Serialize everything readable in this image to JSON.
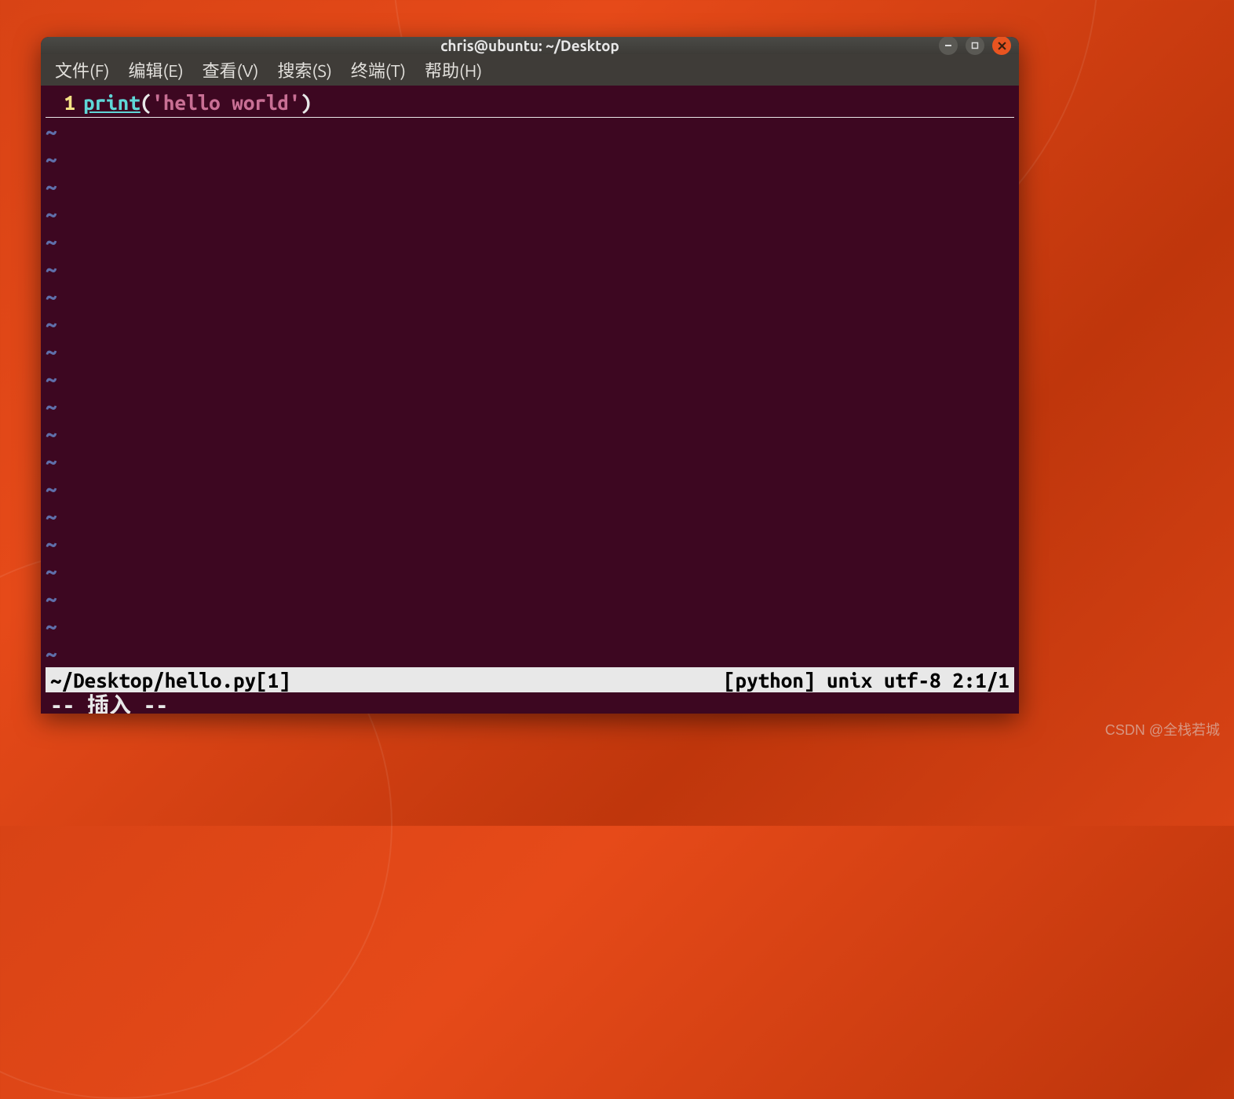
{
  "window": {
    "title": "chris@ubuntu: ~/Desktop"
  },
  "menubar": {
    "file": "文件(F)",
    "edit": "编辑(E)",
    "view": "查看(V)",
    "search": "搜索(S)",
    "terminal": "终端(T)",
    "help": "帮助(H)"
  },
  "editor": {
    "line_number": "1",
    "code": {
      "keyword": "print",
      "open_paren": "(",
      "string": "'hello world'",
      "close_paren": ")"
    },
    "tilde": "~",
    "tilde_count": 20
  },
  "statusbar": {
    "left": " ~/Desktop/hello.py[1] ",
    "right": "[python]  unix utf-8 2:1/1 "
  },
  "modeline": "-- 插入 --",
  "watermark": "CSDN @全栈若城"
}
